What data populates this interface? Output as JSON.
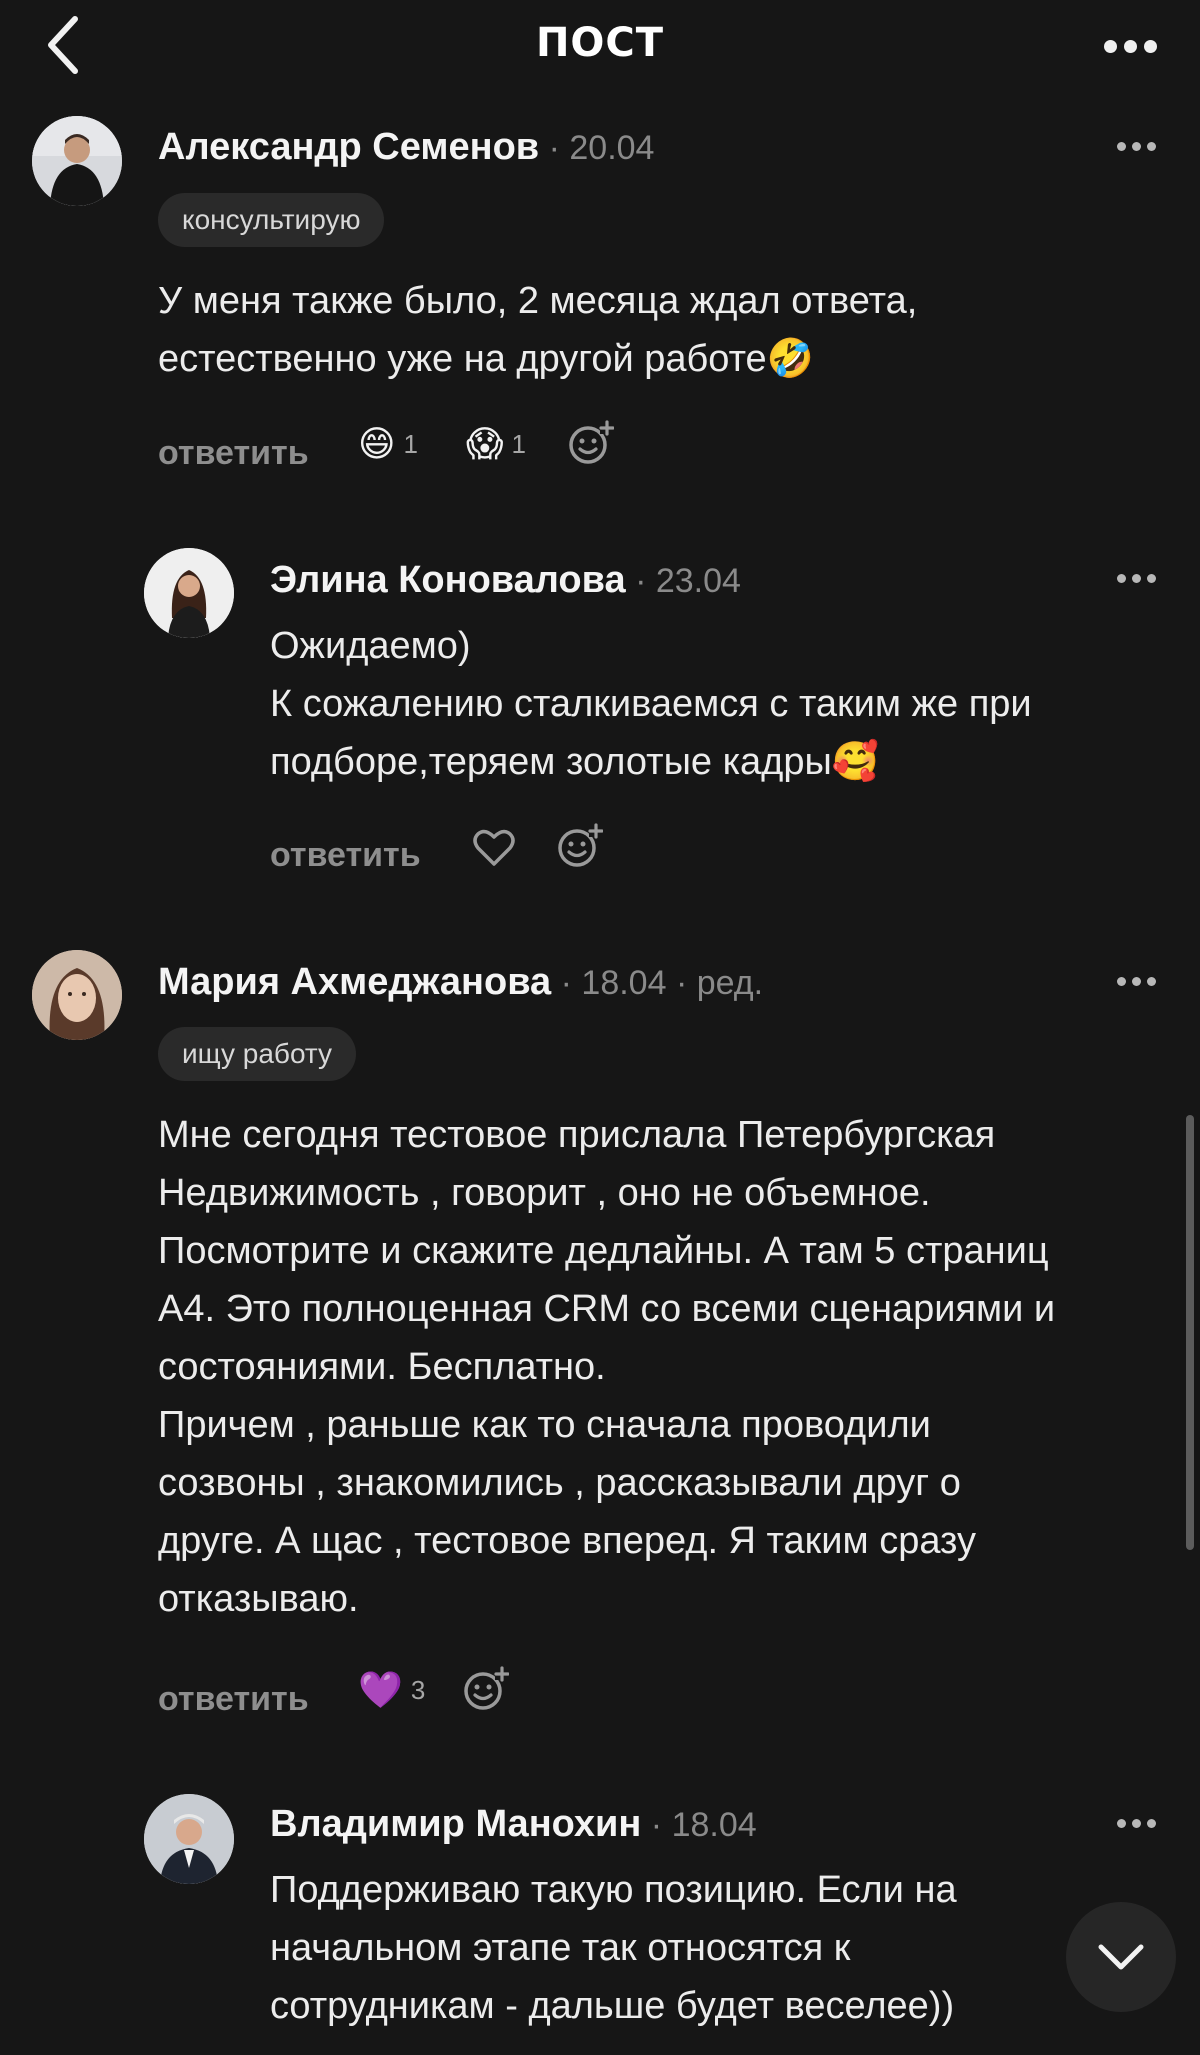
{
  "header": {
    "title": "ПОСТ"
  },
  "comments": [
    {
      "author": "Александр Семенов",
      "date": "20.04",
      "edited": "",
      "badge": "консультирую",
      "text": "У меня также было, 2 месяца ждал ответа,\nестественно уже на другой работе",
      "text_emoji": "🤣",
      "reply_label": "ответить",
      "reactions": [
        {
          "emoji": "😄",
          "count": "1"
        },
        {
          "emoji": "😱",
          "count": "1"
        }
      ]
    },
    {
      "author": "Элина Коновалова",
      "date": "23.04",
      "edited": "",
      "badge": "",
      "text": "Ожидаемо)\nК сожалению сталкиваемся с таким же при\nподборе,теряем золотые кадры",
      "text_emoji": "🥰",
      "reply_label": "ответить",
      "reactions": []
    },
    {
      "author": "Мария Ахмеджанова",
      "date": "18.04",
      "edited": "ред.",
      "badge": "ищу работу",
      "text": "Мне сегодня тестовое прислала Петербургская\nНедвижимость , говорит , оно не объемное.\nПосмотрите и скажите дедлайны. А там 5 страниц\nА4. Это полноценная CRM со всеми сценариями и\nсостояниями. Бесплатно.\nПричем , раньше как то сначала проводили\nсозвоны , знакомились , рассказывали друг о\nдруге. А щас , тестовое вперед. Я таким сразу\nотказываю.",
      "text_emoji": "",
      "reply_label": "ответить",
      "reactions": [
        {
          "emoji": "💜",
          "count": "3"
        }
      ]
    },
    {
      "author": "Владимир Манохин",
      "date": "18.04",
      "edited": "",
      "badge": "",
      "text": "Поддерживаю такую позицию. Если на\nначальном этапе так относятся к\nсотрудникам - дальше будет веселее))",
      "text_emoji": "",
      "reply_label": "",
      "reactions": []
    }
  ],
  "separator": " · ",
  "icons": {
    "back": "chevron-left-icon",
    "more": "more-horizontal-icon",
    "add_reaction": "add-emoji-icon",
    "like": "heart-outline-icon",
    "scroll_down": "chevron-down-icon"
  },
  "colors": {
    "background": "#161616",
    "text": "#f2f2f2",
    "muted": "#8a8a8a",
    "badge_bg": "#2a2a2a"
  }
}
